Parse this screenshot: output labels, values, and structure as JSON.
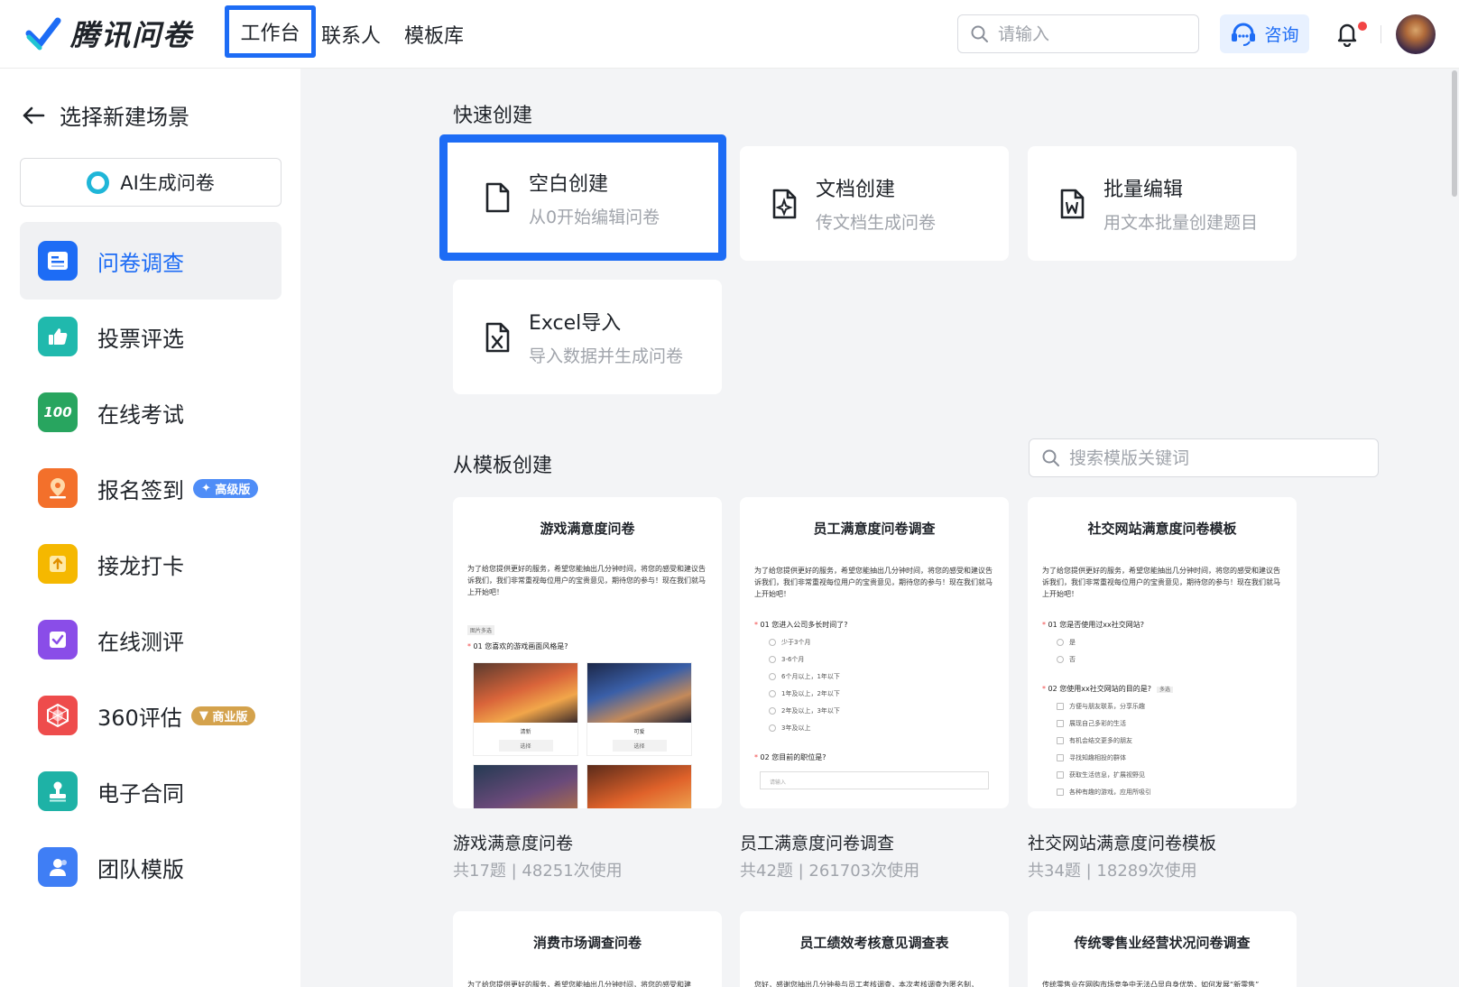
{
  "header": {
    "app_name": "腾讯问卷",
    "nav": [
      {
        "label": "工作台",
        "active": true
      },
      {
        "label": "联系人",
        "active": false
      },
      {
        "label": "模板库",
        "active": false
      }
    ],
    "search_placeholder": "请输入",
    "consult_label": "咨询",
    "notification_dot": true
  },
  "sidebar": {
    "back_label": "选择新建场景",
    "ai_button": "AI生成问卷",
    "items": [
      {
        "label": "问卷调查",
        "icon": "survey-icon",
        "active": true
      },
      {
        "label": "投票评选",
        "icon": "thumbs-up-icon"
      },
      {
        "label": "在线考试",
        "icon": "score-100-icon"
      },
      {
        "label": "报名签到",
        "icon": "location-pin-icon",
        "badge": "高级版"
      },
      {
        "label": "接龙打卡",
        "icon": "upload-checkin-icon"
      },
      {
        "label": "在线测评",
        "icon": "checkbox-icon"
      },
      {
        "label": "360评估",
        "icon": "radar-icon",
        "badge": "商业版"
      },
      {
        "label": "电子合同",
        "icon": "stamp-icon"
      },
      {
        "label": "团队模版",
        "icon": "team-icon"
      }
    ]
  },
  "quick_create": {
    "title": "快速创建",
    "cards": [
      {
        "title": "空白创建",
        "subtitle": "从0开始编辑问卷",
        "icon": "blank-doc-icon"
      },
      {
        "title": "文档创建",
        "subtitle": "传文档生成问卷",
        "icon": "doc-sparkle-icon"
      },
      {
        "title": "批量编辑",
        "subtitle": "用文本批量创建题目",
        "icon": "word-doc-icon"
      },
      {
        "title": "Excel导入",
        "subtitle": "导入数据并生成问卷",
        "icon": "excel-doc-icon"
      }
    ]
  },
  "templates": {
    "title": "从模板创建",
    "search_placeholder": "搜索模版关键词",
    "cards": [
      {
        "preview_title": "游戏满意度问卷",
        "intro": "为了给您提供更好的服务，希望您能抽出几分钟时间，将您的感受和建议告诉我们，我们非常重视每位用户的宝贵意见，期待您的参与！现在我们就马上开始吧！",
        "tag": "图片多选",
        "question": "01 您喜欢的游戏画面风格是?",
        "images": [
          {
            "caption": "清新",
            "button": "选择"
          },
          {
            "caption": "可爱",
            "button": "选择"
          }
        ],
        "name": "游戏满意度问卷",
        "meta": "共17题 | 48251次使用"
      },
      {
        "preview_title": "员工满意度问卷调查",
        "intro": "为了给您提供更好的服务，希望您能抽出几分钟时间，将您的感受和建议告诉我们，我们非常重视每位用户的宝贵意见，期待您的参与！现在我们就马上开始吧！",
        "question": "01 您进入公司多长时间了?",
        "options": [
          "少于3个月",
          "3-6个月",
          "6个月以上，1年以下",
          "1年及以上，2年以下",
          "2年及以上，3年以下",
          "3年及以上"
        ],
        "question2": "02 您目前的职位是?",
        "input_placeholder": "请输入",
        "name": "员工满意度问卷调查",
        "meta": "共42题 | 261703次使用"
      },
      {
        "preview_title": "社交网站满意度问卷模板",
        "intro": "为了给您提供更好的服务，希望您能抽出几分钟时间，将您的感受和建议告诉我们，我们非常重视每位用户的宝贵意见，期待您的参与！现在我们就马上开始吧！",
        "question": "01 您是否使用过xx社交网站?",
        "options": [
          "是",
          "否"
        ],
        "question2": "02 您使用xx社交网站的目的是?",
        "question2_tag": "多选",
        "options2": [
          "方便与朋友联系，分享乐趣",
          "展现自己多彩的生活",
          "有机会结交更多的朋友",
          "寻找知趣相投的群体",
          "获取生活信息，扩展视野见",
          "各种有趣的游戏，应用所吸引"
        ],
        "name": "社交网站满意度问卷模板",
        "meta": "共34题 | 18289次使用"
      },
      {
        "preview_title": "消费市场调查问卷",
        "intro": "为了给您提供更好的服务，希望您能抽出几分钟时间，将您的感受和建"
      },
      {
        "preview_title": "员工绩效考核意见调查表",
        "intro": "您好，感谢您抽出几分钟参与员工考核调查，本次考核调查为匿名制，"
      },
      {
        "preview_title": "传统零售业经营状况问卷调查",
        "intro": "传统零售业在网购市场竞争中无法凸显自身优势，如何发展“新零售”"
      }
    ]
  },
  "colors": {
    "accent": "#1d6cf5",
    "badge_pro": "#4f8df7",
    "badge_business": "#d4a24c"
  }
}
